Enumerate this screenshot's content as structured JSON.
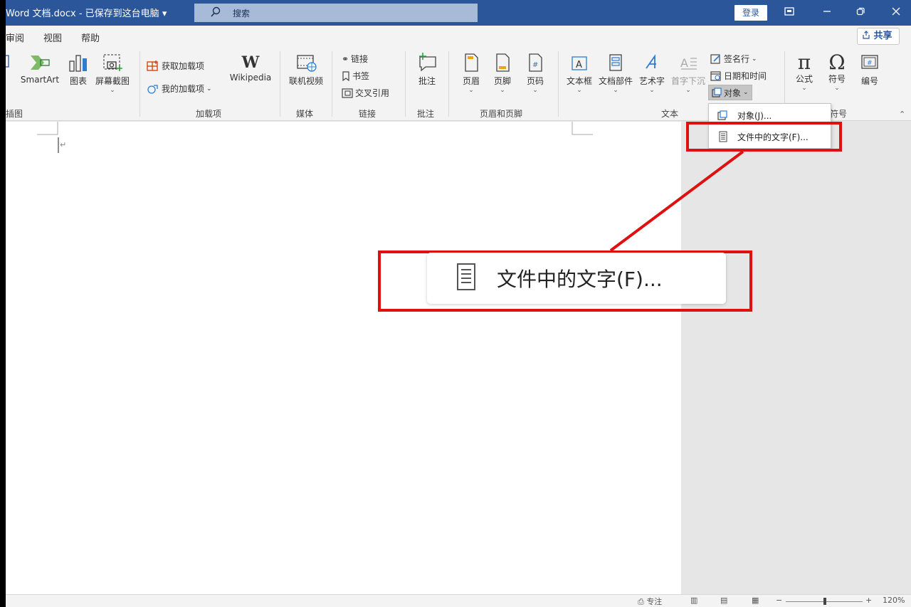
{
  "titlebar": {
    "doc_title": "Word 文档.docx  -  已保存到这台电脑 ▾",
    "search_placeholder": "搜索",
    "login_label": "登录"
  },
  "menu": {
    "tabs": [
      "审阅",
      "视图",
      "帮助"
    ],
    "share_label": "共享"
  },
  "ribbon": {
    "illustrations": {
      "smartart": "SmartArt",
      "chart": "图表",
      "screenshot": "屏幕截图",
      "group": "插图"
    },
    "addins": {
      "get": "获取加载项",
      "my": "我的加载项",
      "wikipedia": "Wikipedia",
      "group": "加载项"
    },
    "media": {
      "video": "联机视频",
      "group": "媒体"
    },
    "links": {
      "link": "链接",
      "bookmark": "书签",
      "crossref": "交叉引用",
      "group": "链接"
    },
    "comments": {
      "comment": "批注",
      "group": "批注"
    },
    "headerfooter": {
      "header": "页眉",
      "footer": "页脚",
      "pagenum": "页码",
      "group": "页眉和页脚"
    },
    "text": {
      "textbox": "文本框",
      "parts": "文档部件",
      "wordart": "艺术字",
      "dropcap": "首字下沉",
      "signature": "签名行",
      "datetime": "日期和时间",
      "object": "对象",
      "group": "文本"
    },
    "symbols": {
      "equation": "公式",
      "symbol": "符号",
      "number": "编号",
      "group": "符号"
    }
  },
  "dropdown": {
    "items": [
      "对象(J)...",
      "文件中的文字(F)..."
    ]
  },
  "callout": {
    "zoom_label": "文件中的文字(F)..."
  },
  "statusbar": {
    "focus": "专注",
    "zoom": "120%"
  },
  "colors": {
    "brand": "#2b579a",
    "highlight": "#e01010"
  }
}
